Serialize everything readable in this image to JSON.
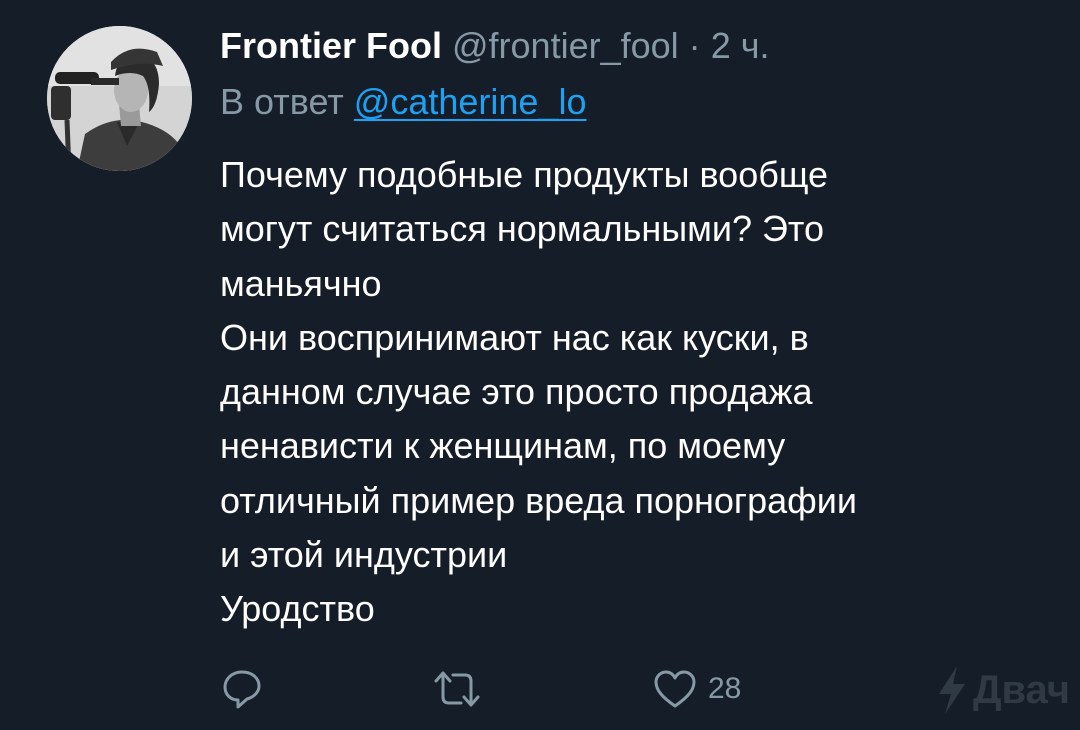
{
  "tweet": {
    "author_name": "Frontier Fool",
    "author_handle": "@frontier_fool",
    "separator": "·",
    "time_ago": "2 ч.",
    "reply_prefix": "В ответ",
    "reply_to": "@catherine_lo",
    "text_lines": [
      "Почему подобные продукты вообще",
      "могут считаться нормальными? Это",
      "маньячно",
      "Они воспринимают нас как куски, в",
      "данном случае это просто продажа",
      "ненависти к женщинам, по моему",
      "отличный пример вреда порнографии",
      "и этой индустрии",
      "Уродство"
    ]
  },
  "actions": {
    "reply_icon": "speech-bubble-icon",
    "retweet_icon": "retweet-arrows-icon",
    "like_icon": "heart-icon",
    "like_count": "28"
  },
  "watermark": {
    "icon": "lightning-bolt-icon",
    "text": "Двач"
  },
  "colors": {
    "background": "#151d28",
    "primary_text": "#ffffff",
    "secondary_text": "#8899a6",
    "link": "#1da1f2"
  }
}
